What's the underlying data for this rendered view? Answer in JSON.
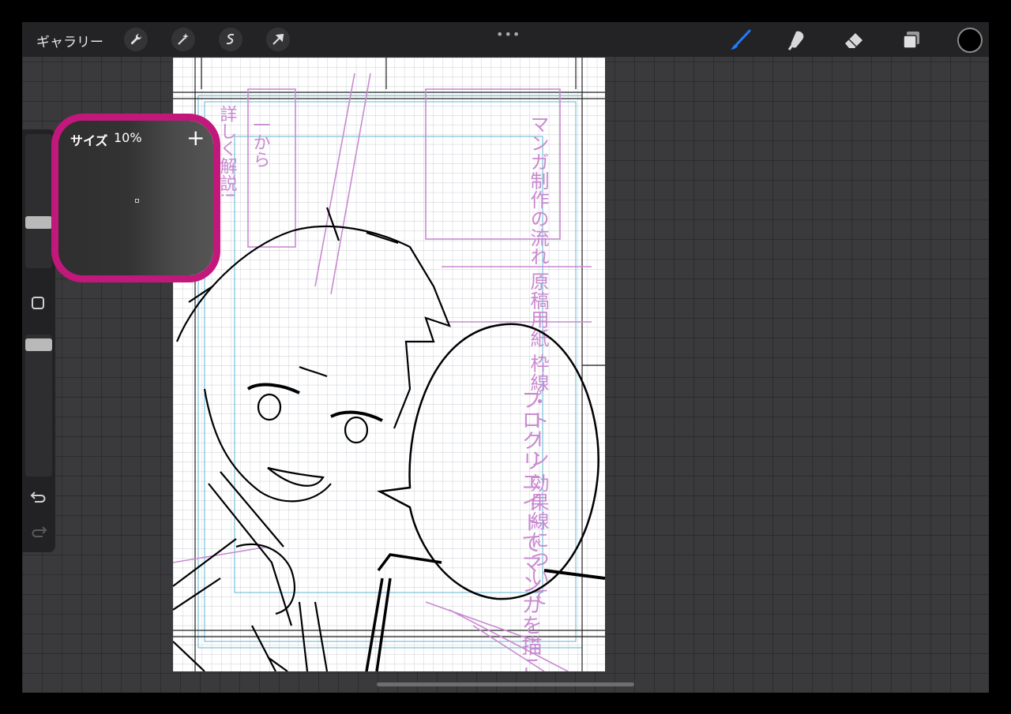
{
  "topbar": {
    "gallery_label": "ギャラリー",
    "left_tools": [
      "wrench-icon",
      "magic-wand-icon",
      "selection-icon",
      "transform-arrow-icon"
    ],
    "right_tools": [
      "brush-icon",
      "smudge-icon",
      "eraser-icon",
      "layers-icon"
    ],
    "active_tool": "brush-icon",
    "active_color": "#000000",
    "accent_color": "#1f7bff"
  },
  "sidebar": {
    "brush_size_slider_level": 0.1,
    "opacity_slider_level": 0.9
  },
  "size_popup": {
    "title": "サイズ",
    "value": "10%",
    "ring_color": "#c2177b"
  },
  "canvas": {
    "speech_text": "プロクリエイトでマンガを描こう!",
    "notes_text": "マンガ制作の流れ 原稿用紙 枠線・トーン 効果線について",
    "side_note_left": "詳しく解説!",
    "side_note_mid": "一から"
  }
}
